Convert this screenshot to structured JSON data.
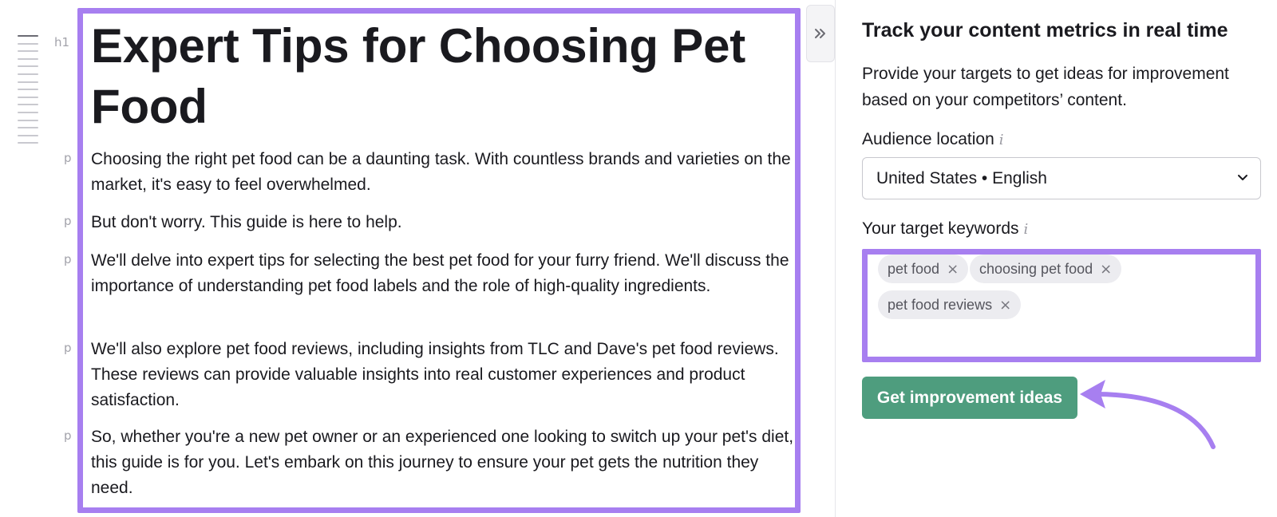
{
  "editor": {
    "h1_tag": "h1",
    "p_tag": "p",
    "title": "Expert Tips for Choosing Pet Food",
    "paragraphs": [
      "Choosing the right pet food can be a daunting task. With countless brands and varieties on the market, it's easy to feel overwhelmed.",
      "But don't worry. This guide is here to help.",
      "We'll delve into expert tips for selecting the best pet food for your furry friend. We'll discuss the importance of understanding pet food labels and the role of high-quality ingredients.",
      "We'll also explore pet food reviews, including insights from TLC and Dave's pet food reviews. These reviews can provide valuable insights into real customer experiences and product satisfaction.",
      "So, whether you're a new pet owner or an experienced one looking to switch up your pet's diet, this guide is for you. Let's embark on this journey to ensure your pet gets the nutrition they need."
    ]
  },
  "panel": {
    "collapse_icon": "double-chevron-right-icon",
    "title": "Track your content metrics in real time",
    "description": "Provide your targets to get ideas for improvement based on your competitors’ content.",
    "audience_label": "Audience location",
    "audience_value": "United States • English",
    "info_glyph": "i",
    "keywords_label": "Your target keywords",
    "keywords": [
      "pet food",
      "choosing pet food",
      "pet food reviews"
    ],
    "remove_glyph": "×",
    "button_label": "Get improvement ideas"
  },
  "colors": {
    "highlight": "#a77ff0",
    "button": "#4e9d7e"
  }
}
